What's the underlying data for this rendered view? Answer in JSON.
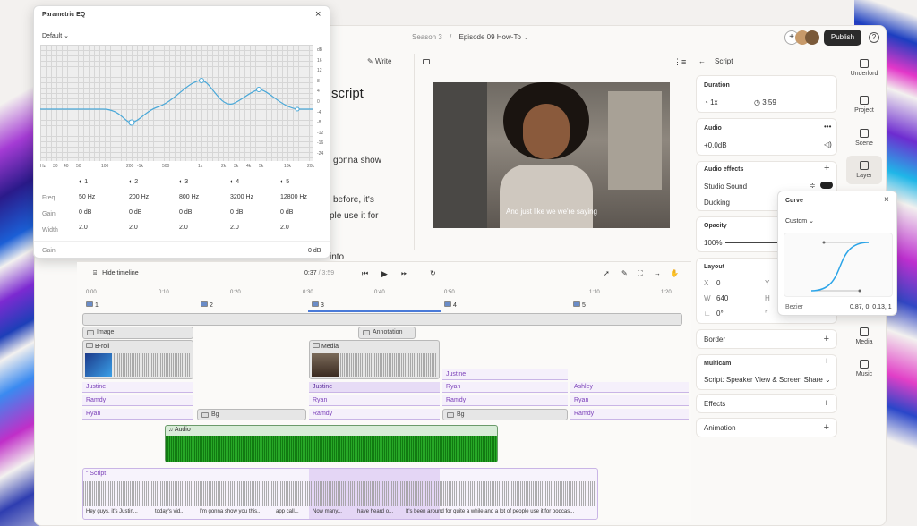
{
  "header": {
    "season": "Season 3",
    "separator": "/",
    "episode": "Episode 09 How-To",
    "publish": "Publish",
    "help": "?"
  },
  "eq": {
    "title": "Parametric EQ",
    "preset": "Default",
    "db_ticks": [
      "dB",
      "16",
      "12",
      "8",
      "4",
      "0",
      "-4",
      "-8",
      "-12",
      "-16",
      "-24"
    ],
    "freq_ticks": [
      "Hz",
      "30",
      "40",
      "50",
      "100",
      "200",
      "-1k",
      "500",
      "1k",
      "2k",
      "3k",
      "4k",
      "5k",
      "10k",
      "20k"
    ],
    "bands": [
      {
        "num": "1",
        "freq": "50 Hz",
        "gain": "0 dB",
        "width": "2.0"
      },
      {
        "num": "2",
        "freq": "200 Hz",
        "gain": "0 dB",
        "width": "2.0"
      },
      {
        "num": "3",
        "freq": "800 Hz",
        "gain": "0 dB",
        "width": "2.0"
      },
      {
        "num": "4",
        "freq": "3200 Hz",
        "gain": "0 dB",
        "width": "2.0"
      },
      {
        "num": "5",
        "freq": "12800 Hz",
        "gain": "0 dB",
        "width": "2.0"
      }
    ],
    "row_freq": "Freq",
    "row_gain": "Gain",
    "row_width": "Width",
    "gain_label": "Gain",
    "gain_value": "0 dB"
  },
  "editor": {
    "write": "Write",
    "title_frag": "script",
    "line1": "gonna show",
    "line2": "before, it's",
    "line3": "ple use it for",
    "line4": "into"
  },
  "video": {
    "caption": "And just like we we're saying"
  },
  "props": {
    "back": "Script",
    "duration_label": "Duration",
    "speed": "1x",
    "time": "3:59",
    "audio_label": "Audio",
    "audio_db": "+0.0dB",
    "effects_label": "Audio effects",
    "studio_sound": "Studio Sound",
    "ducking": "Ducking",
    "opacity_label": "Opacity",
    "opacity_val": "100%",
    "layout_label": "Layout",
    "x_label": "X",
    "x_val": "0",
    "y_label": "Y",
    "w_label": "W",
    "w_val": "640",
    "h_label": "H",
    "rot_val": "0°",
    "border": "Border",
    "multicam": "Multicam",
    "multicam_val": "Script: Speaker View & Screen Share",
    "effects": "Effects",
    "animation": "Animation"
  },
  "curve": {
    "title": "Curve",
    "preset": "Custom",
    "bezier_label": "Bezier",
    "bezier_val": "0.87, 0, 0.13, 1"
  },
  "sidebar": [
    {
      "label": "Underlord"
    },
    {
      "label": "Project"
    },
    {
      "label": "Scene"
    },
    {
      "label": "Layer"
    },
    {
      "label": "Media"
    },
    {
      "label": "Music"
    }
  ],
  "timeline": {
    "hide": "Hide timeline",
    "current": "0:37",
    "sep": "/",
    "total": "3:59",
    "ticks": [
      "0:00",
      "0:10",
      "0:20",
      "0:30",
      "0:40",
      "0:50",
      "1:10",
      "1:20"
    ],
    "scenes": [
      "1",
      "2",
      "3",
      "4",
      "5"
    ],
    "tracks": {
      "image": "Image",
      "annotation": "Annotation",
      "broll": "B-roll",
      "media": "Media",
      "justine": "Justine",
      "ryan": "Ryan",
      "ramdy": "Ramdy",
      "ashley": "Ashley",
      "bg": "Bg",
      "audio": "Audio",
      "script": "Script"
    },
    "script_words": [
      "Hey guys, it's Justin...",
      "today's vid...",
      "I'm gonna show you this...",
      "app call...",
      "Now many...",
      "have heard o...",
      "It's been around for quite a while and a lot of people use it for podcas..."
    ]
  }
}
